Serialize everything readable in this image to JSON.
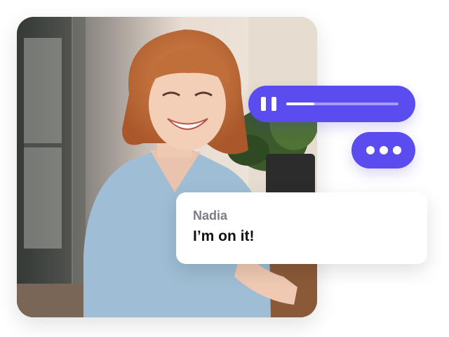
{
  "message": {
    "sender": "Nadia",
    "text": "I’m on it!"
  },
  "audio_player": {
    "state_icon": "pause-icon",
    "progress": 0.25
  },
  "typing_indicator": {
    "icon": "ellipsis-icon",
    "dots": 3
  },
  "colors": {
    "accent": "#5b4cf0",
    "card_background": "#ffffff",
    "sender_text": "#7c7c86",
    "message_text": "#111111"
  }
}
